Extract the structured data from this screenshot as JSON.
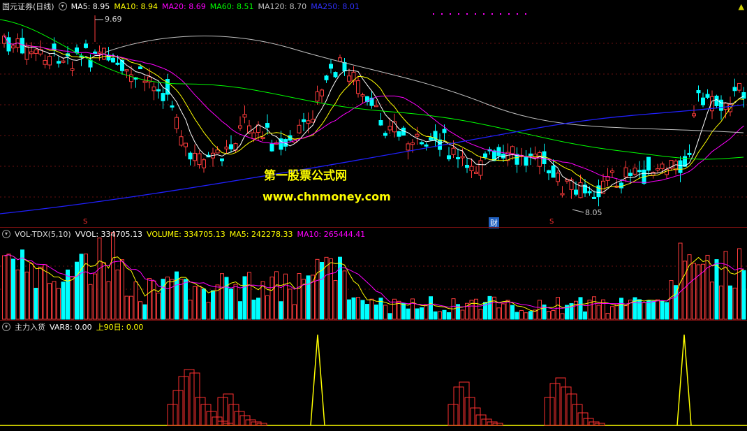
{
  "price_panel": {
    "title": "国元证券(日线)",
    "ma_items": [
      {
        "label": "MA5: 8.95",
        "color": "#ffffff"
      },
      {
        "label": "MA10: 8.94",
        "color": "#ffff00"
      },
      {
        "label": "MA20: 8.69",
        "color": "#ff00ff"
      },
      {
        "label": "MA60: 8.51",
        "color": "#00ff00"
      },
      {
        "label": "MA120: 8.70",
        "color": "#c0c0c0"
      },
      {
        "label": "MA250: 8.01",
        "color": "#2020ff"
      }
    ],
    "high_label": "9.69",
    "low_label": "8.05",
    "marker_cai": "财",
    "marker_s1": "S",
    "marker_s2": "S"
  },
  "watermark": {
    "line1": "第一股票公式网",
    "line2": "www.chnmoney.com"
  },
  "vol_panel": {
    "title": "VOL-TDX(5,10)",
    "items": [
      {
        "label": "VVOL: 334705.13",
        "color": "#ffffff"
      },
      {
        "label": "VOLUME: 334705.13",
        "color": "#ffff00"
      },
      {
        "label": "MA5: 242278.33",
        "color": "#ffff00"
      },
      {
        "label": "MA10: 265444.41",
        "color": "#ff00ff"
      }
    ]
  },
  "ind_panel": {
    "title": "主力入货",
    "items": [
      {
        "label": "VAR8: 0.00",
        "color": "#ffffff"
      },
      {
        "label": "上90日: 0.00",
        "color": "#ffff00"
      }
    ]
  },
  "colors": {
    "up": "#ff3c3c",
    "down": "#00ffff",
    "grid": "#7a1010"
  }
}
